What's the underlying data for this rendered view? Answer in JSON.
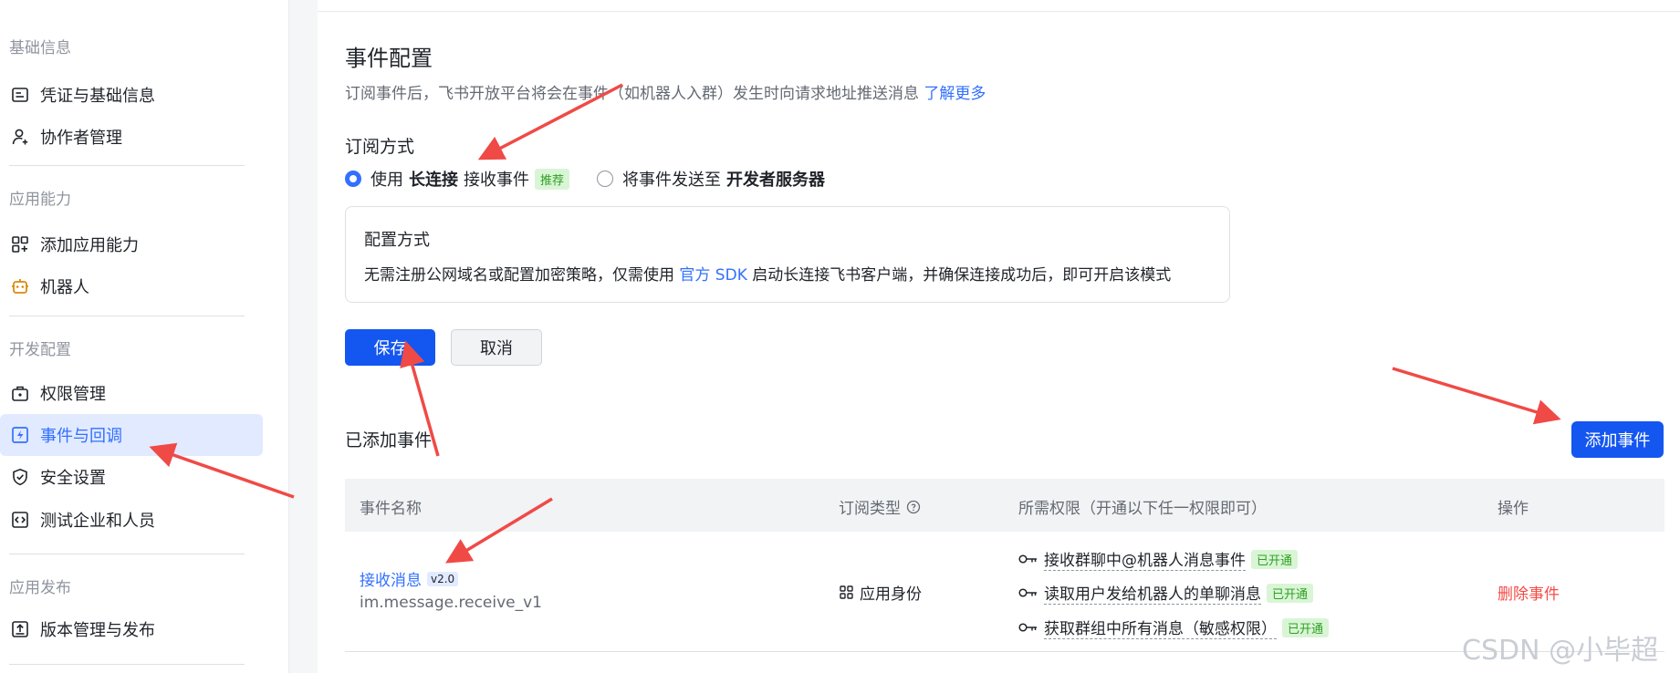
{
  "sidebar": {
    "sections": [
      {
        "title": "基础信息",
        "items": [
          {
            "label": "凭证与基础信息",
            "icon": "credential-icon"
          },
          {
            "label": "协作者管理",
            "icon": "user-add-icon"
          }
        ]
      },
      {
        "title": "应用能力",
        "items": [
          {
            "label": "添加应用能力",
            "icon": "apps-add-icon"
          },
          {
            "label": "机器人",
            "icon": "robot-icon"
          }
        ]
      },
      {
        "title": "开发配置",
        "items": [
          {
            "label": "权限管理",
            "icon": "lock-briefcase-icon"
          },
          {
            "label": "事件与回调",
            "icon": "event-callback-icon",
            "active": true
          },
          {
            "label": "安全设置",
            "icon": "shield-icon"
          },
          {
            "label": "测试企业和人员",
            "icon": "code-test-icon"
          }
        ]
      },
      {
        "title": "应用发布",
        "items": [
          {
            "label": "版本管理与发布",
            "icon": "upload-icon"
          }
        ]
      }
    ]
  },
  "main": {
    "title": "事件配置",
    "description": "订阅事件后，飞书开放平台将会在事件（如机器人入群）发生时向请求地址推送消息",
    "learn_more": "了解更多",
    "subscription_label": "订阅方式",
    "option1": {
      "prefix": "使用",
      "bold": "长连接",
      "suffix": "接收事件",
      "tag": "推荐",
      "selected": true
    },
    "option2": {
      "prefix": "将事件发送至",
      "bold": "开发者服务器",
      "selected": false
    },
    "config_box": {
      "title": "配置方式",
      "text_before": "无需注册公网域名或配置加密策略，仅需使用",
      "link": "官方 SDK",
      "text_after": "启动长连接飞书客户端，并确保连接成功后，即可开启该模式"
    },
    "save_label": "保存",
    "cancel_label": "取消",
    "added_events_title": "已添加事件",
    "add_event_label": "添加事件",
    "table": {
      "headers": {
        "name": "事件名称",
        "type": "订阅类型",
        "permissions": "所需权限（开通以下任一权限即可）",
        "actions": "操作"
      },
      "rows": [
        {
          "name": "接收消息",
          "version": "v2.0",
          "key": "im.message.receive_v1",
          "type": "应用身份",
          "permissions": [
            {
              "label": "接收群聊中@机器人消息事件",
              "status": "已开通"
            },
            {
              "label": "读取用户发给机器人的单聊消息",
              "status": "已开通"
            },
            {
              "label": "获取群组中所有消息（敏感权限）",
              "status": "已开通"
            }
          ],
          "action": "删除事件"
        }
      ]
    }
  },
  "watermark": "CSDN @小毕超",
  "colors": {
    "primary": "#1456f0",
    "link": "#3370ff",
    "active_bg": "#e1eaff",
    "success": "#2ea121",
    "danger": "#f54a45",
    "annotation_arrow": "#f04a46"
  }
}
